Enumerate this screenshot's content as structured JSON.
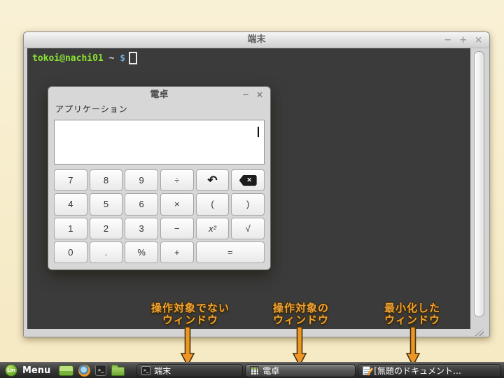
{
  "terminal_window": {
    "title": "端末",
    "minimize_label": "−",
    "maximize_label": "+",
    "close_label": "×",
    "prompt_user_host": "tokoi@nachi01",
    "prompt_path": " ~ ",
    "prompt_symbol": "$"
  },
  "calculator_window": {
    "title": "電卓",
    "minimize_label": "−",
    "close_label": "×",
    "menu_label": "アプリケーション",
    "display_value": "",
    "buttons": [
      {
        "label": "7"
      },
      {
        "label": "8"
      },
      {
        "label": "9"
      },
      {
        "label": "÷"
      },
      {
        "label": "↶",
        "name": "undo"
      },
      {
        "label": "⌫",
        "name": "backspace"
      },
      {
        "label": "4"
      },
      {
        "label": "5"
      },
      {
        "label": "6"
      },
      {
        "label": "×"
      },
      {
        "label": "("
      },
      {
        "label": ")"
      },
      {
        "label": "1"
      },
      {
        "label": "2"
      },
      {
        "label": "3"
      },
      {
        "label": "−"
      },
      {
        "label": "x²",
        "name": "x-squared"
      },
      {
        "label": "√",
        "name": "square-root"
      },
      {
        "label": "0"
      },
      {
        "label": "."
      },
      {
        "label": "%"
      },
      {
        "label": "+"
      },
      {
        "label": "=",
        "name": "equals"
      }
    ],
    "backspace_glyph": "✕"
  },
  "annotations": [
    {
      "line1": "操作対象でない",
      "line2": "ウィンドウ"
    },
    {
      "line1": "操作対象の",
      "line2": "ウィンドウ"
    },
    {
      "line1": "最小化した",
      "line2": "ウィンドウ"
    }
  ],
  "taskbar": {
    "menu_label": "Menu",
    "mint_logo_glyph": "Lm",
    "terminal_icon_glyph": ">_",
    "task_buttons": [
      {
        "label": "端末",
        "state": "inactive"
      },
      {
        "label": "電卓",
        "state": "active"
      },
      {
        "label": "[無題のドキュメント…",
        "state": "minimized"
      }
    ]
  },
  "colors": {
    "desktop_cream": "#f7edc9",
    "terminal_background": "#3b3b3b",
    "prompt_green": "#8ae234",
    "prompt_blue": "#6ea7d8",
    "annotation_orange": "#f1a233",
    "arrow_orange": "#ee9526",
    "mint_green": "#76b235"
  }
}
